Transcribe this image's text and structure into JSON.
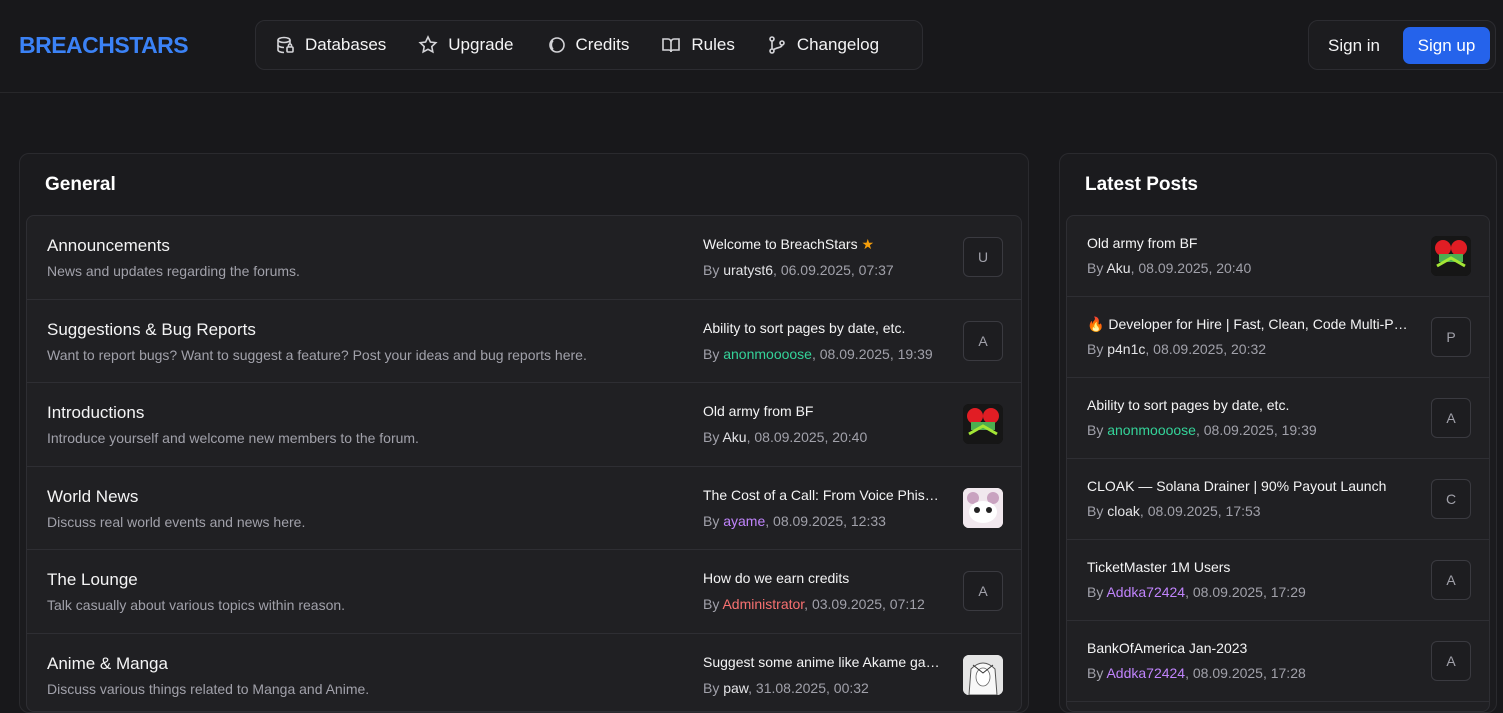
{
  "brand": "BREACHSTARS",
  "nav": [
    {
      "label": "Databases",
      "icon": "database-icon"
    },
    {
      "label": "Upgrade",
      "icon": "star-icon"
    },
    {
      "label": "Credits",
      "icon": "credits-icon"
    },
    {
      "label": "Rules",
      "icon": "book-icon"
    },
    {
      "label": "Changelog",
      "icon": "git-branch-icon"
    }
  ],
  "auth": {
    "signin": "Sign in",
    "signup": "Sign up"
  },
  "general": {
    "title": "General",
    "forums": [
      {
        "name": "Announcements",
        "desc": "News and updates regarding the forums.",
        "last_title": "Welcome to BreachStars",
        "by": "By ",
        "user": "uratyst6",
        "date": ", 06.09.2025, 07:37",
        "avatar": "U"
      },
      {
        "name": "Suggestions & Bug Reports",
        "desc": "Want to report bugs? Want to suggest a feature? Post your ideas and bug reports here.",
        "last_title": "Ability to sort pages by date, etc.",
        "by": "By ",
        "user": "anonmoooose",
        "date": ", 08.09.2025, 19:39",
        "avatar": "A"
      },
      {
        "name": "Introductions",
        "desc": "Introduce yourself and welcome new members to the forum.",
        "last_title": "Old army from BF",
        "by": "By ",
        "user": "Aku",
        "date": ", 08.09.2025, 20:40",
        "avatar": ""
      },
      {
        "name": "World News",
        "desc": "Discuss real world events and news here.",
        "last_title": "The Cost of a Call: From Voice Phishing",
        "by": "By ",
        "user": "ayame",
        "date": ", 08.09.2025, 12:33",
        "avatar": ""
      },
      {
        "name": "The Lounge",
        "desc": "Talk casually about various topics within reason.",
        "last_title": "How do we earn credits",
        "by": "By ",
        "user": "Administrator",
        "date": ", 03.09.2025, 07:12",
        "avatar": "A"
      },
      {
        "name": "Anime & Manga",
        "desc": "Discuss various things related to Manga and Anime.",
        "last_title": "Suggest some anime like Akame ga Kill",
        "by": "By ",
        "user": "paw",
        "date": ", 31.08.2025, 00:32",
        "avatar": ""
      }
    ]
  },
  "latest": {
    "title": "Latest Posts",
    "posts": [
      {
        "title": "Old army from BF",
        "by": "By ",
        "user": "Aku",
        "date": ", 08.09.2025, 20:40",
        "avatar": ""
      },
      {
        "title": "Developer for Hire | Fast, Clean, Code Multi-Platform",
        "by": "By ",
        "user": "p4n1c",
        "date": ", 08.09.2025, 20:32",
        "avatar": "P"
      },
      {
        "title": "Ability to sort pages by date, etc.",
        "by": "By ",
        "user": "anonmoooose",
        "date": ", 08.09.2025, 19:39",
        "avatar": "A"
      },
      {
        "title": "CLOAK — Solana Drainer | 90% Payout Launch",
        "by": "By ",
        "user": "cloak",
        "date": ", 08.09.2025, 17:53",
        "avatar": "C"
      },
      {
        "title": "TicketMaster 1M Users",
        "by": "By ",
        "user": "Addka72424",
        "date": ", 08.09.2025, 17:29",
        "avatar": "A"
      },
      {
        "title": "BankOfAmerica Jan-2023",
        "by": "By ",
        "user": "Addka72424",
        "date": ", 08.09.2025, 17:28",
        "avatar": "A"
      }
    ]
  }
}
